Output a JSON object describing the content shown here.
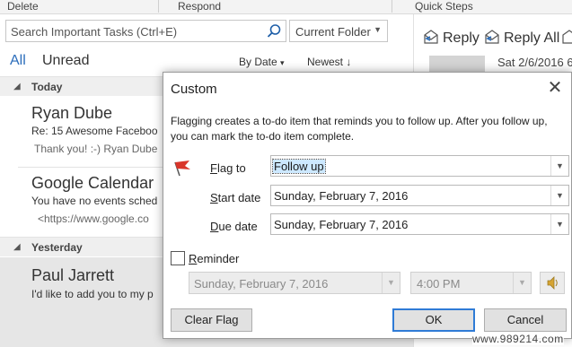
{
  "ribbon": {
    "groups": [
      "Delete",
      "Respond",
      "Quick Steps"
    ]
  },
  "search": {
    "placeholder": "Search Important Tasks (Ctrl+E)",
    "scope": "Current Folder"
  },
  "tabs": {
    "all": "All",
    "unread": "Unread"
  },
  "sort": {
    "by": "By Date",
    "by_arrow": "▾",
    "order": "Newest",
    "order_arrow": "↓"
  },
  "groups": {
    "today": "Today",
    "yesterday": "Yesterday"
  },
  "messages": [
    {
      "sender": "Ryan Dube",
      "subject": "Re: 15 Awesome Faceboo",
      "preview": "Thank you! :-)  Ryan Dube"
    },
    {
      "sender": "Google Calendar",
      "subject": "You have no events sched",
      "preview": "<https://www.google.co"
    },
    {
      "sender": "Paul Jarrett",
      "subject": "I'd like to add you to my p",
      "preview": ""
    }
  ],
  "reading_pane": {
    "reply": "Reply",
    "reply_all": "Reply All",
    "date": "Sat 2/6/2016 6"
  },
  "dialog": {
    "title": "Custom",
    "close": "✕",
    "description": "Flagging creates a to-do item that reminds you to follow up. After you follow up, you can mark the to-do item complete.",
    "flag_to": {
      "label_u": "F",
      "label_rest": "lag to",
      "value": "Follow up"
    },
    "start_date": {
      "label_u": "S",
      "label_rest": "tart date",
      "value": "Sunday, February 7, 2016"
    },
    "due_date": {
      "label_u": "D",
      "label_rest": "ue date",
      "value": "Sunday, February 7, 2016"
    },
    "reminder": {
      "label_u": "R",
      "label_rest": "eminder",
      "checked": false,
      "date": "Sunday, February 7, 2016",
      "time": "4:00 PM"
    },
    "buttons": {
      "clear_flag": "Clear Flag",
      "ok": "OK",
      "cancel": "Cancel"
    }
  },
  "watermark": "www.989214.com",
  "colors": {
    "accent": "#2b6dbb",
    "flag": "#d9352a",
    "selection": "#cce8ff"
  }
}
